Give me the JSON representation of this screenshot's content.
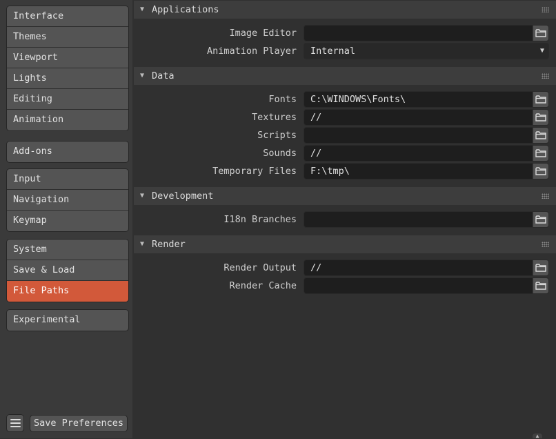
{
  "sidebar": {
    "groups": [
      [
        {
          "label": "Interface"
        },
        {
          "label": "Themes"
        },
        {
          "label": "Viewport"
        },
        {
          "label": "Lights"
        },
        {
          "label": "Editing"
        },
        {
          "label": "Animation"
        }
      ],
      [
        {
          "label": "Add-ons"
        }
      ],
      [
        {
          "label": "Input"
        },
        {
          "label": "Navigation"
        },
        {
          "label": "Keymap"
        }
      ],
      [
        {
          "label": "System"
        },
        {
          "label": "Save & Load"
        },
        {
          "label": "File Paths"
        }
      ],
      [
        {
          "label": "Experimental"
        }
      ]
    ],
    "active": "File Paths",
    "save_label": "Save Preferences"
  },
  "sections": {
    "applications": {
      "title": "Applications",
      "image_editor": {
        "label": "Image Editor",
        "value": ""
      },
      "animation_player": {
        "label": "Animation Player",
        "value": "Internal"
      }
    },
    "data": {
      "title": "Data",
      "fonts": {
        "label": "Fonts",
        "value": "C:\\WINDOWS\\Fonts\\"
      },
      "textures": {
        "label": "Textures",
        "value": "//"
      },
      "scripts": {
        "label": "Scripts",
        "value": ""
      },
      "sounds": {
        "label": "Sounds",
        "value": "//"
      },
      "temporary_files": {
        "label": "Temporary Files",
        "value": "F:\\tmp\\"
      }
    },
    "development": {
      "title": "Development",
      "i18n_branches": {
        "label": "I18n Branches",
        "value": ""
      }
    },
    "render": {
      "title": "Render",
      "render_output": {
        "label": "Render Output",
        "value": "//"
      },
      "render_cache": {
        "label": "Render Cache",
        "value": ""
      }
    }
  },
  "colors": {
    "accent": "#d2593a",
    "background": "#303030",
    "panel_header": "#3d3d3d",
    "field": "#1e1e1e"
  },
  "icons": {
    "folder": "folder-icon",
    "collapse": "triangle-down-icon",
    "menu": "hamburger-menu-icon",
    "drag": "drag-grip-icon"
  }
}
